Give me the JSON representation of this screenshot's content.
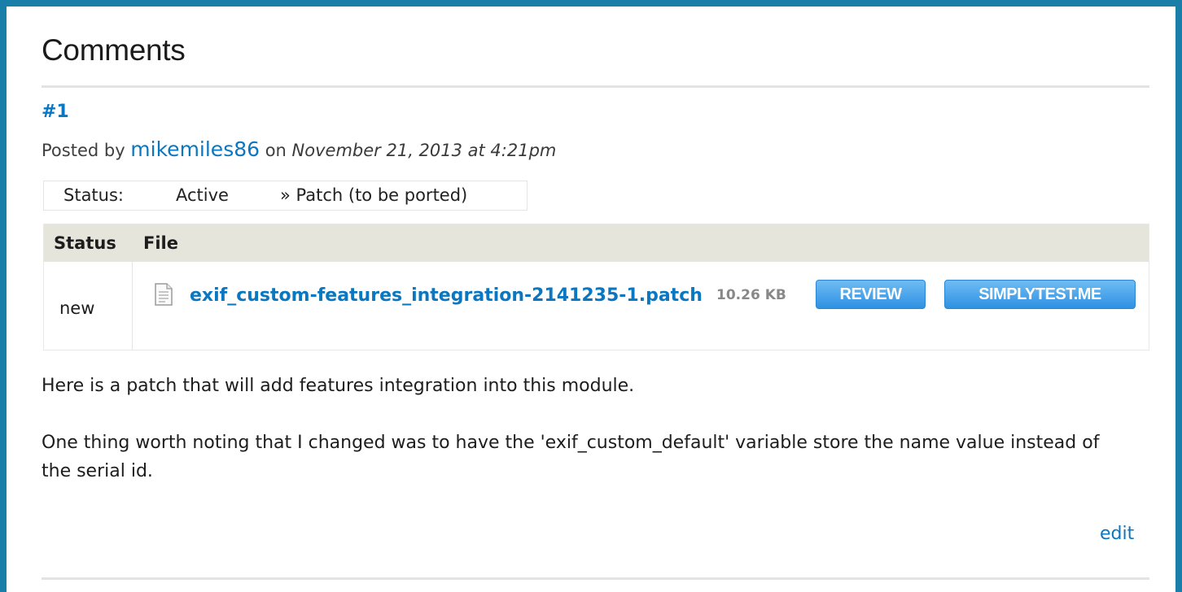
{
  "heading": "Comments",
  "comment": {
    "permalink": "#1",
    "posted_by_prefix": "Posted by ",
    "author": "mikemiles86",
    "on_text": " on ",
    "date": "November 21, 2013 at 4:21pm",
    "status_change": {
      "label": "Status:",
      "from": "Active",
      "to": "» Patch (to be ported)"
    },
    "files_table": {
      "headers": {
        "status": "Status",
        "file": "File"
      },
      "rows": [
        {
          "status": "new",
          "icon": "file-icon",
          "name": "exif_custom-features_integration-2141235-1.patch",
          "size": "10.26 KB",
          "review_label": "REVIEW",
          "simplytest_label": "SIMPLYTEST.ME"
        }
      ]
    },
    "body": [
      "Here is a patch that will add features integration into this module.",
      "One thing worth noting that I changed was to have the 'exif_custom_default' variable store the name value instead of the serial id."
    ],
    "edit_label": "edit"
  },
  "colors": {
    "background": "#1a7fa8",
    "link": "#0a77c0",
    "button": "#2f91e3",
    "table_header": "#e6e5dc"
  }
}
